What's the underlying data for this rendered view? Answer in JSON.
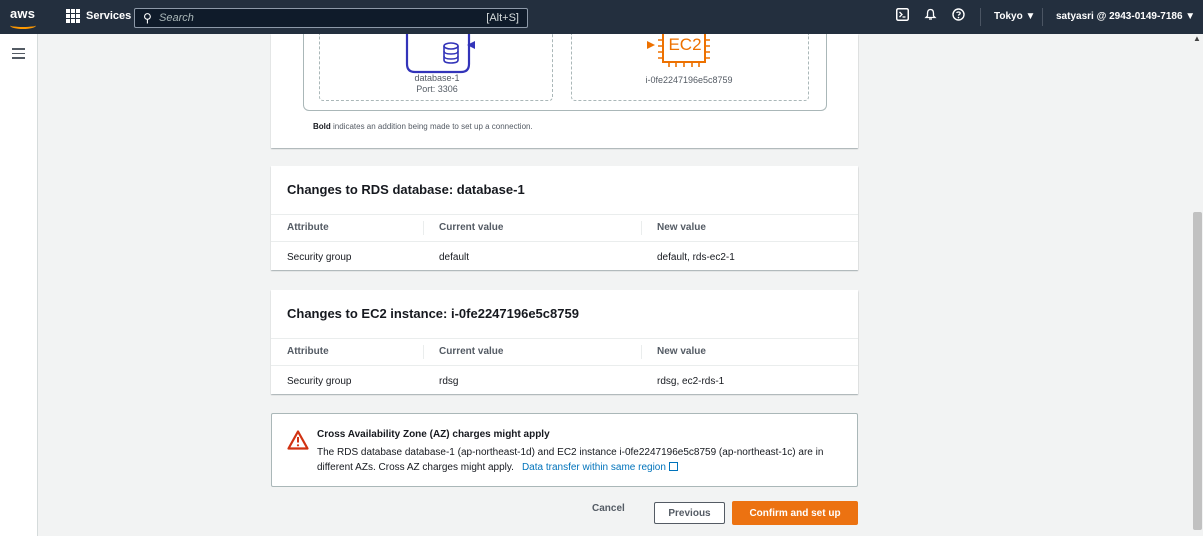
{
  "topnav": {
    "logo": "aws",
    "services_label": "Services",
    "search_placeholder": "Search",
    "search_shortcut": "[Alt+S]",
    "region": "Tokyo ▼",
    "account": "satyasri @ 2943-0149-7186 ▼",
    "icons": [
      "cloudshell-icon",
      "bell-icon",
      "help-icon"
    ]
  },
  "diagram": {
    "db_name": "database-1",
    "db_port": "Port: 3306",
    "ec2_label": "EC2",
    "ec2_instance": "i-0fe2247196e5c8759",
    "note_bold": "Bold",
    "note_rest": " indicates an addition being made to set up a connection."
  },
  "rds_changes": {
    "title": "Changes to RDS database: database-1",
    "headers": [
      "Attribute",
      "Current value",
      "New value"
    ],
    "rows": [
      [
        "Security group",
        "default",
        "default, rds-ec2-1"
      ]
    ]
  },
  "ec2_changes": {
    "title": "Changes to EC2 instance: i-0fe2247196e5c8759",
    "headers": [
      "Attribute",
      "Current value",
      "New value"
    ],
    "rows": [
      [
        "Security group",
        "rdsg",
        "rdsg, ec2-rds-1"
      ]
    ]
  },
  "alert": {
    "title": "Cross Availability Zone (AZ) charges might apply",
    "body": "The RDS database database-1 (ap-northeast-1d) and EC2 instance i-0fe2247196e5c8759 (ap-northeast-1c) are in different AZs. Cross AZ charges might apply.",
    "link": "Data transfer within same region"
  },
  "actions": {
    "cancel": "Cancel",
    "previous": "Previous",
    "confirm": "Confirm and set up"
  },
  "colors": {
    "nav_bg": "#232f3e",
    "rds_blue": "#3334b9",
    "ec2_orange": "#ed7100",
    "primary": "#ec7211",
    "warning": "#d13212",
    "link": "#0073bb"
  }
}
